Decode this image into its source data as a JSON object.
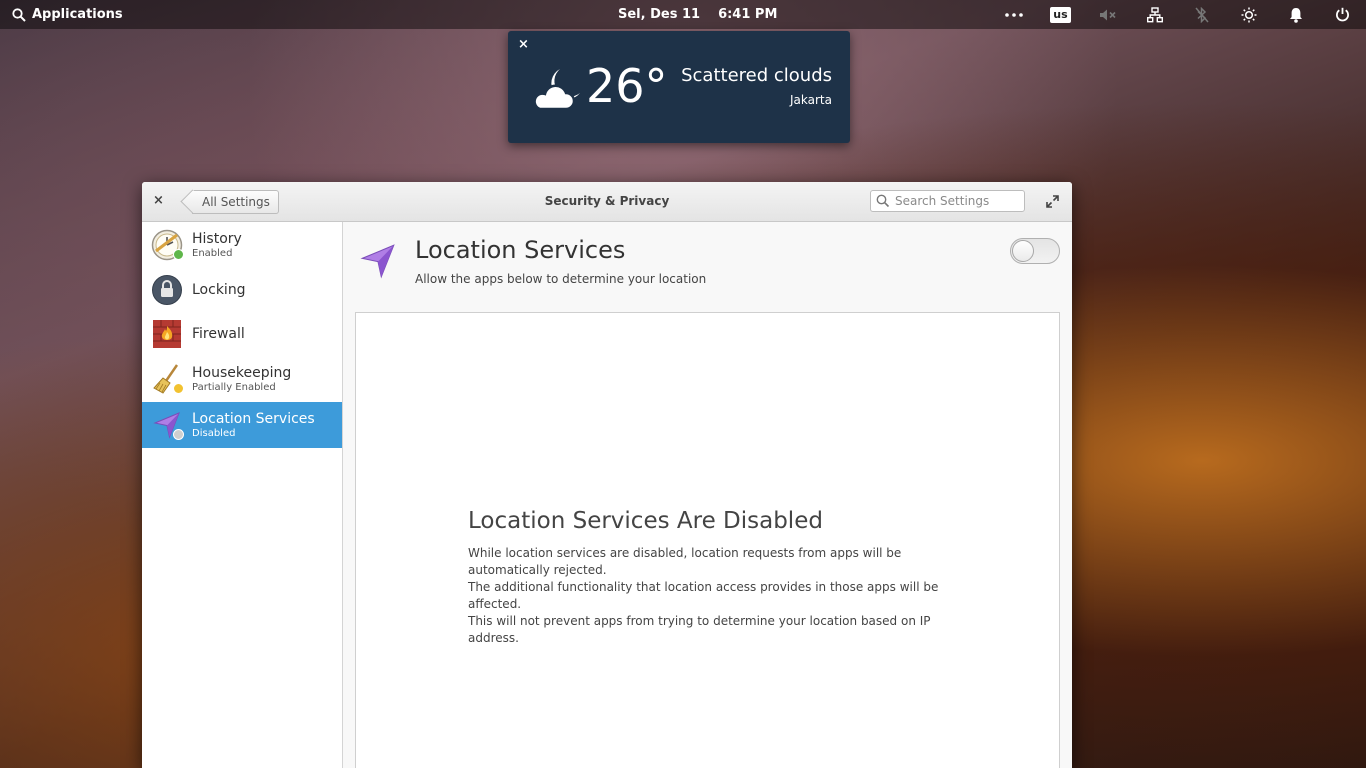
{
  "panel": {
    "applications_label": "Applications",
    "date": "Sel, Des 11",
    "time": "6:41 PM",
    "keyboard_layout": "us"
  },
  "weather": {
    "temperature": "26°",
    "condition": "Scattered clouds",
    "city": "Jakarta",
    "close_glyph": "×"
  },
  "window": {
    "title": "Security & Privacy",
    "back_label": "All Settings",
    "close_glyph": "×",
    "search_placeholder": "Search Settings"
  },
  "sidebar": {
    "items": [
      {
        "name": "History",
        "status": "Enabled",
        "icon": "history-icon",
        "status_color": "#5fb64a"
      },
      {
        "name": "Locking",
        "status": "",
        "icon": "lock-icon"
      },
      {
        "name": "Firewall",
        "status": "",
        "icon": "firewall-icon"
      },
      {
        "name": "Housekeeping",
        "status": "Partially Enabled",
        "icon": "broom-icon",
        "status_color": "#f2c230"
      },
      {
        "name": "Location Services",
        "status": "Disabled",
        "icon": "location-arrow-icon",
        "status_color": "#c8c8c8",
        "active": true
      }
    ]
  },
  "main": {
    "title": "Location Services",
    "subtitle": "Allow the apps below to determine your location",
    "toggle_on": false,
    "placeholder_title": "Location Services Are Disabled",
    "placeholder_lines": [
      "While location services are disabled, location requests from apps will be automatically rejected.",
      "The additional functionality that location access provides in those apps will be affected.",
      "This will not prevent apps from trying to determine your location based on IP address."
    ]
  },
  "colors": {
    "accent": "#3d9bda",
    "weather_bg": "#1e3248",
    "location_purple": "#a46ee0"
  }
}
